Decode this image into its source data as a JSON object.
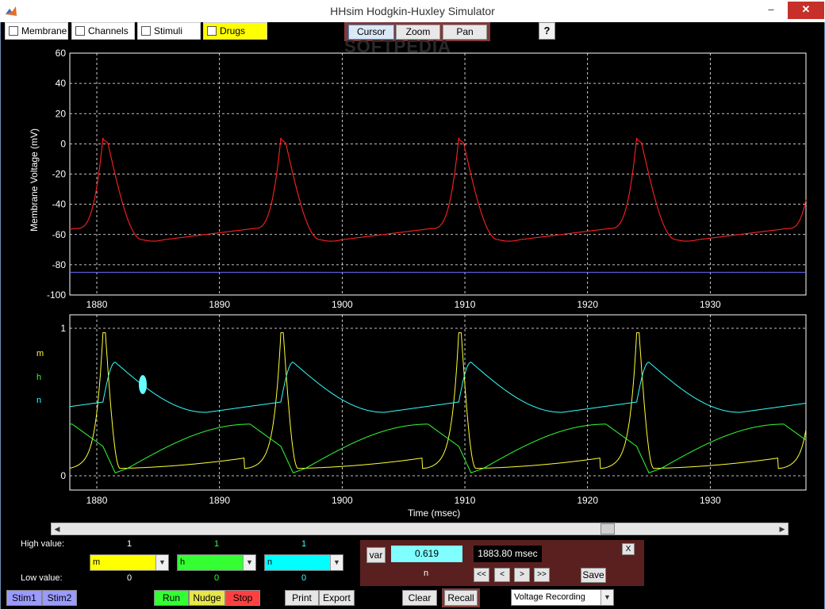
{
  "window": {
    "title": "HHsim Hodgkin-Huxley Simulator",
    "minimize": "–",
    "maximize": "□",
    "close": "✕"
  },
  "top_checks": [
    {
      "label": "Membrane",
      "checked": false
    },
    {
      "label": "Channels",
      "checked": false
    },
    {
      "label": "Stimuli",
      "checked": false
    },
    {
      "label": "Drugs",
      "checked": false
    }
  ],
  "tools": {
    "cursor": "Cursor",
    "zoom": "Zoom",
    "pan": "Pan",
    "help": "?"
  },
  "watermark": "SOFTPEDIA",
  "voltage_chart": {
    "ylabel": "Membrane Voltage (mV)",
    "yticks": [
      "60",
      "40",
      "20",
      "0",
      "-20",
      "-40",
      "-60",
      "-80",
      "-100"
    ],
    "xticks": [
      "1880",
      "1890",
      "1900",
      "1910",
      "1920",
      "1930"
    ],
    "colors": {
      "trace": "#ff2020",
      "baseline": "#6a6aff"
    }
  },
  "gates_chart": {
    "xlabel": "Time (msec)",
    "yticks": [
      "1",
      "0"
    ],
    "xticks": [
      "1880",
      "1890",
      "1900",
      "1910",
      "1920",
      "1930"
    ],
    "var_labels": [
      {
        "name": "m",
        "color": "#ffff33"
      },
      {
        "name": "h",
        "color": "#33ff33"
      },
      {
        "name": "n",
        "color": "#33ffff"
      }
    ]
  },
  "chart_data": [
    {
      "type": "line",
      "ylabel": "Membrane Voltage (mV)",
      "xlim": [
        1877.8,
        1937.8
      ],
      "ylim": [
        -100,
        60
      ],
      "spike_times": [
        1880.5,
        1895.0,
        1909.5,
        1924.0
      ],
      "series": [
        {
          "values_desc": "repeating action potentials peaking near +3 mV, resting near -64 mV"
        },
        {
          "constant": -85
        }
      ]
    },
    {
      "type": "line",
      "xlabel": "Time (msec)",
      "xlim": [
        1877.8,
        1937.8
      ],
      "ylim": [
        0,
        1
      ],
      "series": [
        {
          "name": "m",
          "peak": 0.97,
          "trough": 0.05
        },
        {
          "name": "h",
          "peak": 0.35,
          "trough": 0.02
        },
        {
          "name": "n",
          "peak": 0.77,
          "trough": 0.43
        }
      ]
    }
  ],
  "controls": {
    "high_label": "High value:",
    "low_label": "Low value:",
    "high_values": [
      "1",
      "1",
      "1"
    ],
    "low_values": [
      "0",
      "0",
      "0"
    ],
    "selects": [
      {
        "value": "m",
        "color": "#ffff00"
      },
      {
        "value": "h",
        "color": "#33ff33"
      },
      {
        "value": "n",
        "color": "#00ffff"
      }
    ]
  },
  "bottom_buttons": {
    "stim1": "Stim1",
    "stim2": "Stim2",
    "run": "Run",
    "nudge": "Nudge",
    "stop": "Stop",
    "print": "Print",
    "export": "Export",
    "clear": "Clear",
    "recall": "Recall"
  },
  "recording_select": "Voltage Recording",
  "cursor_panel": {
    "var_button": "var",
    "value": "0.619",
    "time": "1883.80 msec",
    "var_name": "n",
    "close": "X",
    "save": "Save",
    "nav": [
      "<<",
      "<",
      ">",
      ">>"
    ]
  }
}
